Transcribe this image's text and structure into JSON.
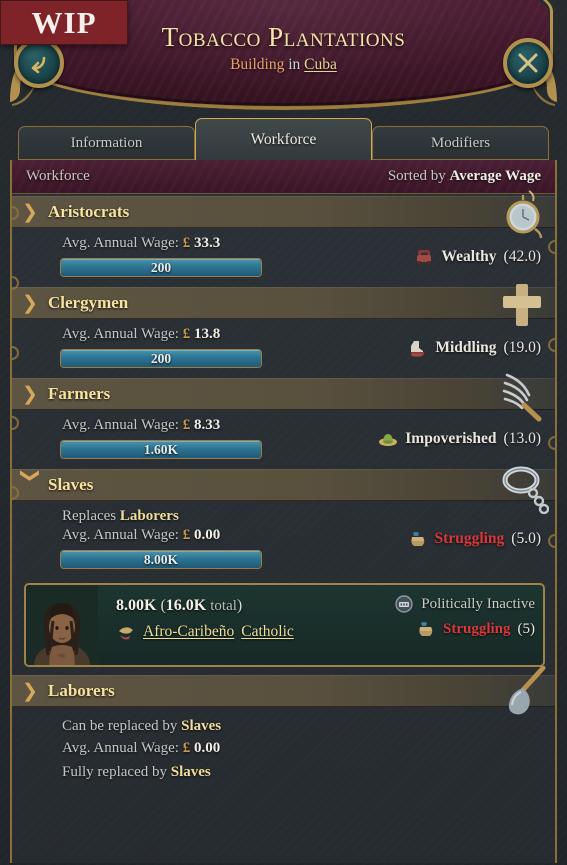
{
  "badge": {
    "label": "WIP"
  },
  "header": {
    "title": "Tobacco Plantations",
    "subtitle_prefix": "Building",
    "subtitle_mid": "in",
    "subtitle_location": "Cuba",
    "back_icon": "back-arrow-icon",
    "close_icon": "close-icon",
    "accent_gold": "#c9a35c",
    "plate_color": "#4a1c31"
  },
  "tabs": [
    {
      "label": "Information",
      "active": false
    },
    {
      "label": "Workforce",
      "active": true
    },
    {
      "label": "Modifiers",
      "active": false
    }
  ],
  "sortbar": {
    "title": "Workforce",
    "sorted_prefix": "Sorted by",
    "sorted_value": "Average Wage"
  },
  "labels": {
    "avg_wage": "Avg. Annual Wage:",
    "currency_symbol": "£",
    "replaces": "Replaces",
    "can_be_replaced_by": "Can be replaced by",
    "fully_replaced_by": "Fully replaced by",
    "total_word": "total"
  },
  "groups": [
    {
      "name": "Aristocrats",
      "icon": "pocket-watch-icon",
      "expanded": false,
      "chevron": "chevron-right-icon",
      "wage": "33.3",
      "bar_label": "200",
      "bar_fill_pct": 100,
      "wealth_label": "Wealthy",
      "wealth_value": "(42.0)",
      "wealth_icon": "armchair-icon",
      "wealth_color": "#eae7df"
    },
    {
      "name": "Clergymen",
      "icon": "cross-icon",
      "expanded": false,
      "chevron": "chevron-right-icon",
      "wage": "13.8",
      "bar_label": "200",
      "bar_fill_pct": 100,
      "wealth_label": "Middling",
      "wealth_value": "(19.0)",
      "wealth_icon": "boot-icon",
      "wealth_color": "#eae7df"
    },
    {
      "name": "Farmers",
      "icon": "pitchfork-icon",
      "expanded": false,
      "chevron": "chevron-right-icon",
      "wage": "8.33",
      "bar_label": "1.60K",
      "bar_fill_pct": 100,
      "wealth_label": "Impoverished",
      "wealth_value": "(13.0)",
      "wealth_icon": "straw-hat-icon",
      "wealth_color": "#eae7df"
    },
    {
      "name": "Slaves",
      "icon": "shackle-icon",
      "expanded": true,
      "chevron": "chevron-down-icon",
      "replaces_target": "Laborers",
      "wage": "0.00",
      "bar_label": "8.00K",
      "bar_fill_pct": 100,
      "wealth_label": "Struggling",
      "wealth_value": "(5.0)",
      "wealth_icon": "sack-icon",
      "wealth_color": "#d9393c"
    }
  ],
  "pop_card": {
    "portrait_icon": "pop-portrait-afro-caribeno",
    "count": "8.00K",
    "total_count": "16.0K",
    "culture": "Afro-Caribeño",
    "religion": "Catholic",
    "culture_icon": "culture-icon",
    "political_status": "Politically Inactive",
    "political_icon": "politically-inactive-icon",
    "wealth_label": "Struggling",
    "wealth_value": "(5)",
    "wealth_icon": "sack-icon"
  },
  "laborers": {
    "name": "Laborers",
    "icon": "shovel-icon",
    "chevron": "chevron-right-icon",
    "replaced_by": "Slaves",
    "wage": "0.00",
    "fully_replaced_by": "Slaves"
  }
}
